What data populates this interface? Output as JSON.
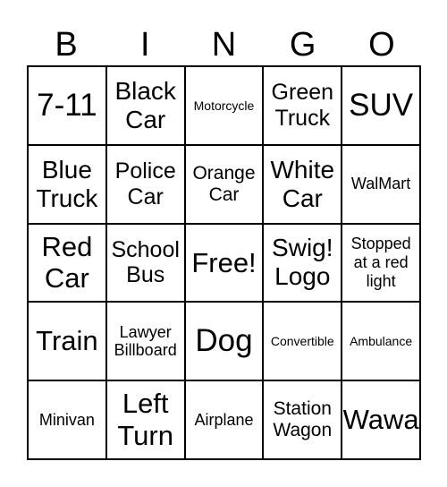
{
  "header": [
    "B",
    "I",
    "N",
    "G",
    "O"
  ],
  "cells": [
    "7-11",
    "Black Car",
    "Motorcycle",
    "Green Truck",
    "SUV",
    "Blue Truck",
    "Police Car",
    "Orange Car",
    "White Car",
    "WalMart",
    "Red Car",
    "School Bus",
    "Free!",
    "Swig! Logo",
    "Stopped at a red light",
    "Train",
    "Lawyer Billboard",
    "Dog",
    "Convertible",
    "Ambulance",
    "Minivan",
    "Left Turn",
    "Airplane",
    "Station Wagon",
    "Wawa"
  ]
}
